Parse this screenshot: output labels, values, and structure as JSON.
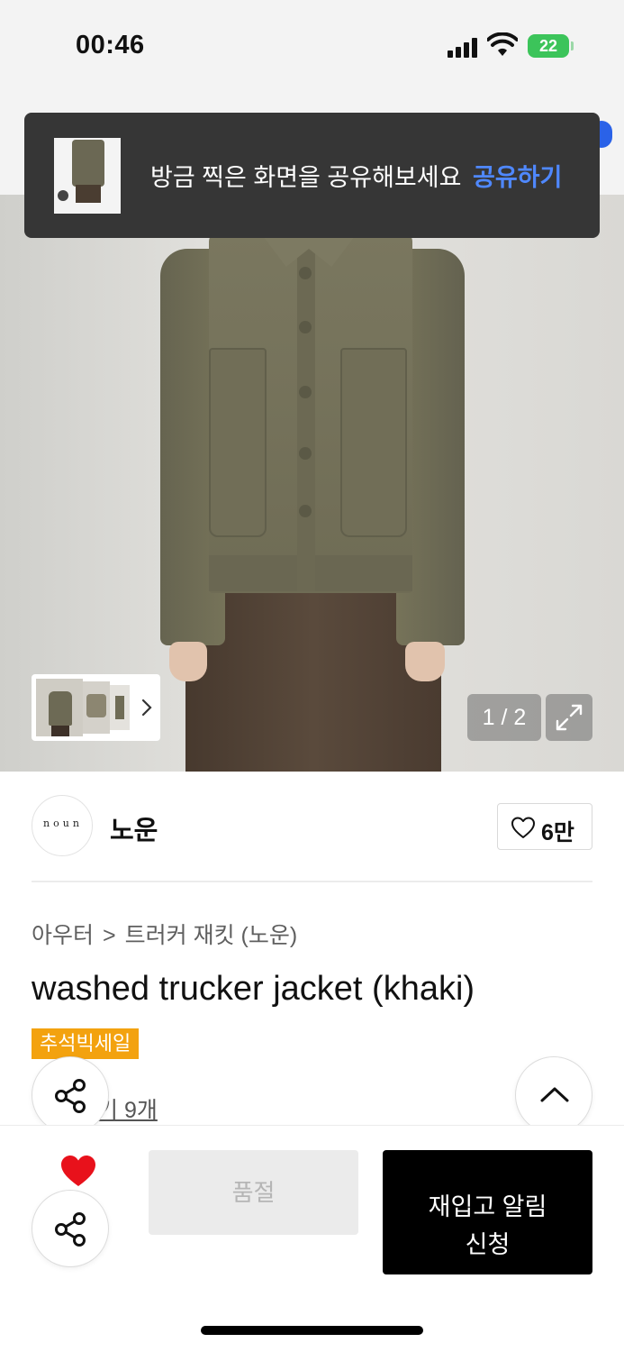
{
  "status_bar": {
    "time": "00:46",
    "battery": "22",
    "icons": [
      "signal-icon",
      "wifi-icon",
      "battery-charging-icon"
    ]
  },
  "toast": {
    "message": "방금 찍은 화면을 공유해보세요",
    "action": "공유하기"
  },
  "gallery": {
    "page_indicator": "1 / 2",
    "current_page": 1,
    "total_pages": 2,
    "thumbnail_count": 3
  },
  "brand": {
    "logo_text": "noun",
    "name": "노운",
    "like_count": "6만"
  },
  "product": {
    "breadcrumb": [
      "아우터",
      "트러커 재킷 (노운)"
    ],
    "title": "washed trucker jacket (khaki)",
    "sale_badge": "추석빅세일",
    "review_link": "기 9개"
  },
  "actions": {
    "soldout_label": "품절",
    "restock_label": "재입고 알림 신청"
  },
  "colors": {
    "accent_blue": "#4f88ff",
    "sale_orange": "#f3a20f",
    "heart_red": "#e8111b",
    "primary_black": "#000000"
  }
}
